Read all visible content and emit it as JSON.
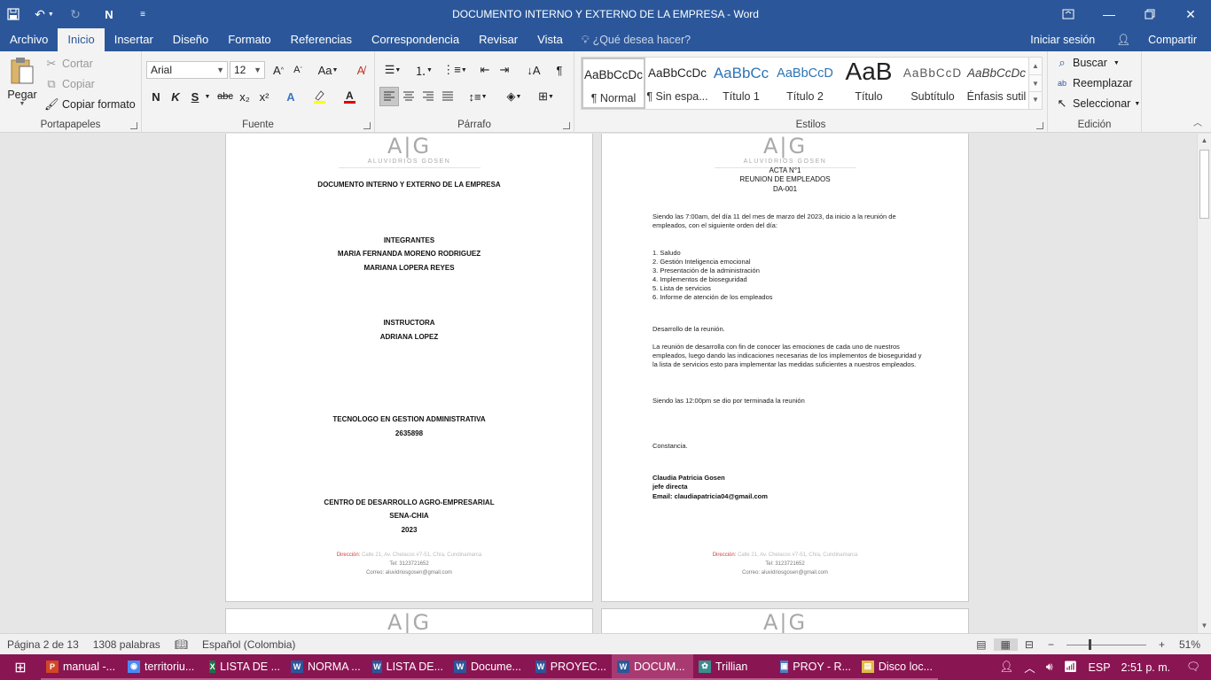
{
  "titlebar": {
    "title": "DOCUMENTO INTERNO Y EXTERNO DE LA EMPRESA - Word",
    "qa_custom": "N"
  },
  "tabs": [
    {
      "label": "Archivo"
    },
    {
      "label": "Inicio"
    },
    {
      "label": "Insertar"
    },
    {
      "label": "Diseño"
    },
    {
      "label": "Formato"
    },
    {
      "label": "Referencias"
    },
    {
      "label": "Correspondencia"
    },
    {
      "label": "Revisar"
    },
    {
      "label": "Vista"
    }
  ],
  "tellme": "¿Qué desea hacer?",
  "signin": "Iniciar sesión",
  "share": "Compartir",
  "clipboard": {
    "paste": "Pegar",
    "cut": "Cortar",
    "copy": "Copiar",
    "format_painter": "Copiar formato",
    "label": "Portapapeles"
  },
  "font": {
    "family": "Arial",
    "size": "12",
    "label": "Fuente"
  },
  "paragraph": {
    "label": "Párrafo"
  },
  "styles": {
    "label": "Estilos",
    "items": [
      {
        "sample": "AaBbCcDc",
        "name": "¶ Normal"
      },
      {
        "sample": "AaBbCcDc",
        "name": "¶ Sin espa..."
      },
      {
        "sample": "AaBbCc",
        "name": "Título 1"
      },
      {
        "sample": "AaBbCcD",
        "name": "Título 2"
      },
      {
        "sample": "AaB",
        "name": "Título"
      },
      {
        "sample": "AaBbCcD",
        "name": "Subtítulo"
      },
      {
        "sample": "AaBbCcDc",
        "name": "Énfasis sutil"
      }
    ]
  },
  "editing": {
    "find": "Buscar",
    "replace": "Reemplazar",
    "select": "Seleccionar",
    "label": "Edición"
  },
  "logo": {
    "mark": "A|G",
    "sub": "ALUVIDRIOS GOSEN"
  },
  "page1": {
    "title": "DOCUMENTO INTERNO Y EXTERNO DE LA EMPRESA",
    "integrantes_h": "INTEGRANTES",
    "member1": "MARIA FERNANDA MORENO RODRIGUEZ",
    "member2": "MARIANA LOPERA REYES",
    "instructora_h": "INSTRUCTORA",
    "instructora": "ADRIANA LOPEZ",
    "program": "TECNOLOGO EN GESTION ADMINISTRATIVA",
    "code": "2635898",
    "center": "CENTRO DE DESARROLLO AGRO-EMPRESARIAL",
    "sena": "SENA-CHIA",
    "year": "2023"
  },
  "page2": {
    "acta": "ACTA N°1",
    "reunion": "REUNION DE EMPLEADOS",
    "code": "DA-001",
    "intro": "Siendo las 7:00am, del día 11 del mes de marzo del 2023, da inicio a la reunión de empleados, con el siguiente orden del día:",
    "agenda": [
      "1. Saludo",
      "2. Gestión Inteligencia emocional",
      "3. Presentación de la administración",
      "4. Implementos de bioseguridad",
      "5. Lista de servicios",
      "6. Informe de atención de los empleados"
    ],
    "dev_h": "Desarrollo de la reunión.",
    "dev": "La reunión de desarrolla con fin de conocer las emociones de cada uno de nuestros empleados, luego dando las indicaciones necesarias de los implementos de bioseguridad y la lista de servicios esto para implementar las medidas suficientes a nuestros empleados.",
    "closing": "Siendo las 12:00pm se dio por terminada la reunión",
    "constancia": "Constancia.",
    "sign_name": "Claudia Patricia Gosen",
    "sign_role": "jefe directa",
    "sign_email": "Email: claudiapatricia04@gmail.com"
  },
  "footer": {
    "dir_label": "Dirección:",
    "dir_value": "Calle 21, Av. Chelacos #7-51, Chía, Cundinamarca",
    "tel": "Tel: 3123721652",
    "mail": "Correo: aluvidriosgosen@gmail.com"
  },
  "status": {
    "page": "Página 2 de 13",
    "words": "1308 palabras",
    "language": "Español (Colombia)",
    "zoom": "51%",
    "zoom_level": 0.51
  },
  "taskbar": {
    "items": [
      {
        "badge": "P",
        "color": "#d24726",
        "label": "manual -..."
      },
      {
        "badge": "◉",
        "color": "#4a8af4",
        "label": "territoriu..."
      },
      {
        "badge": "X",
        "color": "#1e7145",
        "label": "LISTA DE ..."
      },
      {
        "badge": "W",
        "color": "#2b579a",
        "label": "NORMA ..."
      },
      {
        "badge": "W",
        "color": "#2b579a",
        "label": "LISTA DE..."
      },
      {
        "badge": "W",
        "color": "#2b579a",
        "label": "Docume..."
      },
      {
        "badge": "W",
        "color": "#2b579a",
        "label": "PROYEC..."
      },
      {
        "badge": "W",
        "color": "#2b579a",
        "label": "DOCUM..."
      },
      {
        "badge": "✿",
        "color": "#3a8d8d",
        "label": "Trillian"
      },
      {
        "badge": "▣",
        "color": "#4f7fc1",
        "label": "PROY - R..."
      },
      {
        "badge": "▤",
        "color": "#e0b94a",
        "label": "Disco loc..."
      }
    ],
    "lang": "ESP",
    "time": "2:51 p. m."
  }
}
